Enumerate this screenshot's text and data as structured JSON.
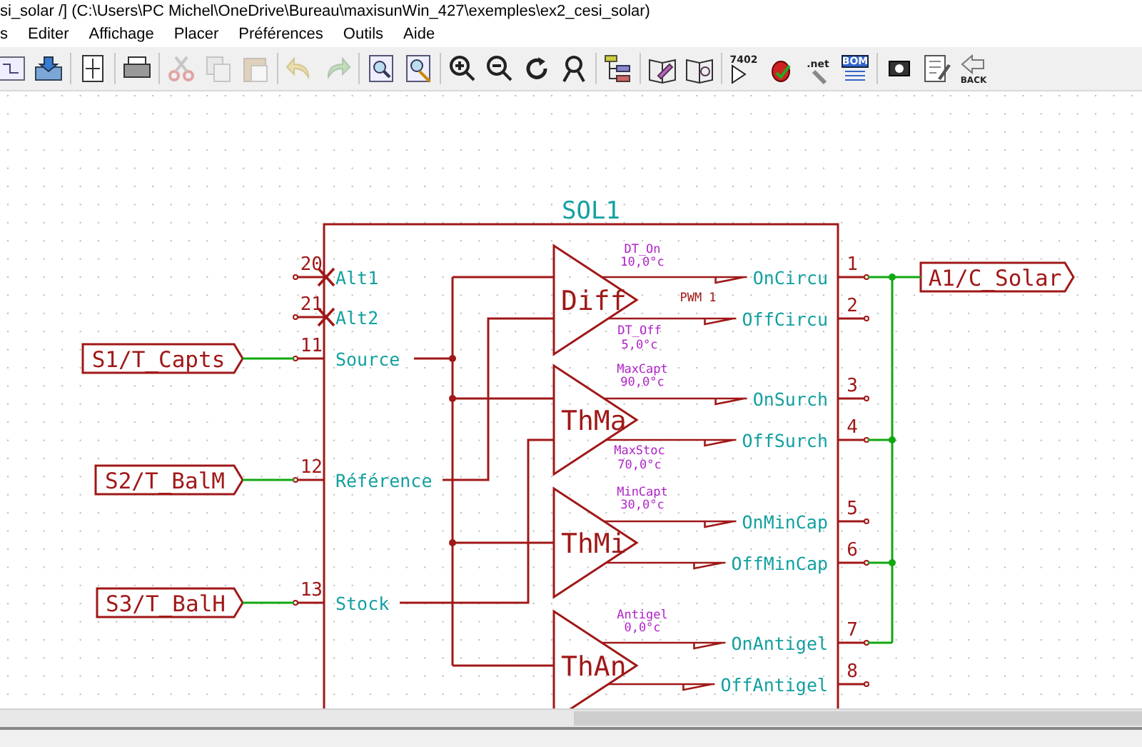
{
  "window": {
    "title": "si_solar /] (C:\\Users\\PC Michel\\OneDrive\\Bureau\\maxisunWin_427\\exemples\\ex2_cesi_solar)"
  },
  "menu": [
    "s",
    "Editer",
    "Affichage",
    "Placer",
    "Préférences",
    "Outils",
    "Aide"
  ],
  "toolbar": [
    {
      "kind": "schematic",
      "disabled": false
    },
    {
      "kind": "save",
      "disabled": false
    },
    {
      "kind": "sep"
    },
    {
      "kind": "page-settings",
      "disabled": false
    },
    {
      "kind": "sep"
    },
    {
      "kind": "print",
      "disabled": false
    },
    {
      "kind": "sep"
    },
    {
      "kind": "cut",
      "disabled": true
    },
    {
      "kind": "copy",
      "disabled": true
    },
    {
      "kind": "paste",
      "disabled": true
    },
    {
      "kind": "sep"
    },
    {
      "kind": "undo",
      "disabled": true
    },
    {
      "kind": "redo",
      "disabled": true
    },
    {
      "kind": "sep"
    },
    {
      "kind": "find",
      "disabled": false
    },
    {
      "kind": "find-replace",
      "disabled": false
    },
    {
      "kind": "sep"
    },
    {
      "kind": "zoom-in",
      "disabled": false
    },
    {
      "kind": "zoom-out",
      "disabled": false
    },
    {
      "kind": "redraw",
      "disabled": false
    },
    {
      "kind": "zoom-fit",
      "disabled": false
    },
    {
      "kind": "sep"
    },
    {
      "kind": "hierarchy",
      "disabled": false
    },
    {
      "kind": "sep"
    },
    {
      "kind": "book-edit",
      "disabled": false
    },
    {
      "kind": "book",
      "disabled": false
    },
    {
      "kind": "sep"
    },
    {
      "kind": "chip",
      "disabled": false,
      "label": "7402"
    },
    {
      "kind": "bug",
      "disabled": false
    },
    {
      "kind": "netlist",
      "disabled": false,
      "label": ".net"
    },
    {
      "kind": "bom",
      "disabled": false,
      "label": "BOM"
    },
    {
      "kind": "sep"
    },
    {
      "kind": "footprint",
      "disabled": false
    },
    {
      "kind": "notes",
      "disabled": false
    },
    {
      "kind": "back",
      "disabled": false,
      "label": "BACK"
    }
  ],
  "schematic": {
    "component": {
      "reference": "SOL1",
      "left_pins": [
        {
          "number": "20",
          "name": "Alt1",
          "no_connect": true
        },
        {
          "number": "21",
          "name": "Alt2",
          "no_connect": true
        },
        {
          "number": "11",
          "name": "Source",
          "no_connect": false
        },
        {
          "number": "12",
          "name": "Référence",
          "no_connect": false
        },
        {
          "number": "13",
          "name": "Stock",
          "no_connect": false
        }
      ],
      "right_pins": [
        {
          "number": "1",
          "name": "OnCircu"
        },
        {
          "number": "2",
          "name": "OffCircu"
        },
        {
          "number": "3",
          "name": "OnSurch"
        },
        {
          "number": "4",
          "name": "OffSurch"
        },
        {
          "number": "5",
          "name": "OnMinCap"
        },
        {
          "number": "6",
          "name": "OffMinCap"
        },
        {
          "number": "7",
          "name": "OnAntigel"
        },
        {
          "number": "8",
          "name": "OffAntigel"
        }
      ]
    },
    "blocks": [
      {
        "name": "Diff",
        "top_param": [
          "DT_On",
          "10,0°c"
        ],
        "bottom_param": [
          "DT_Off",
          "5,0°c"
        ],
        "mode": "PWM 1"
      },
      {
        "name": "ThMa",
        "top_param": [
          "MaxCapt",
          "90,0°c"
        ],
        "bottom_param": [
          "MaxStoc",
          "70,0°c"
        ]
      },
      {
        "name": "ThMi",
        "top_param": [
          "MinCapt",
          "30,0°c"
        ]
      },
      {
        "name": "ThAn",
        "top_param": [
          "Antigel",
          "0,0°c"
        ]
      }
    ],
    "input_labels": [
      "S1/T_Capts",
      "S2/T_BalM",
      "S3/T_BalH"
    ],
    "output_label": "A1/C_Solar"
  }
}
